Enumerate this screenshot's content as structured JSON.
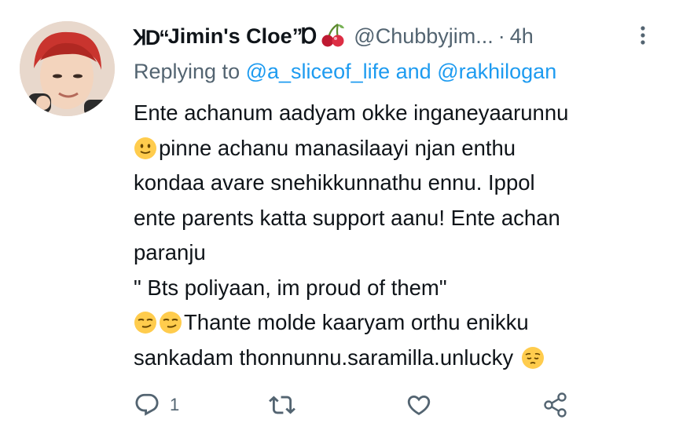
{
  "tweet": {
    "display_name": "Jimin's Cloe",
    "name_deco_left": "ꞰD“",
    "name_deco_right": "”Ɒ",
    "handle": "@Chubbyjim...",
    "separator": "·",
    "time": "4h",
    "replying_prefix": "Replying to",
    "replying_user1": "@a_sliceof_life",
    "replying_and": "and",
    "replying_user2": "@rakhilogan",
    "lines": [
      "Ente achanum aadyam okke inganeyaarunnu",
      "pinne achanu manasilaayi njan enthu",
      "kondaa avare snehikkunnathu ennu. Ippol",
      "ente parents katta support aanu! Ente achan",
      "paranju",
      "\" Bts poliyaan, im proud of them\"",
      "Thante molde kaaryam orthu enikku",
      "sankadam thonnunnu.saramilla.unlucky"
    ],
    "emojis": {
      "line2": "slightly-smiling-face",
      "line7": "smirking-face x2",
      "line8_end": "pensive-face"
    }
  },
  "actions": {
    "reply_count": "1",
    "icons": [
      "reply-icon",
      "retweet-icon",
      "like-icon",
      "share-icon"
    ]
  },
  "colors": {
    "text": "#0f1419",
    "secondary": "#536471",
    "link": "#1d9bf0",
    "emoji": "#ffcc4d"
  }
}
